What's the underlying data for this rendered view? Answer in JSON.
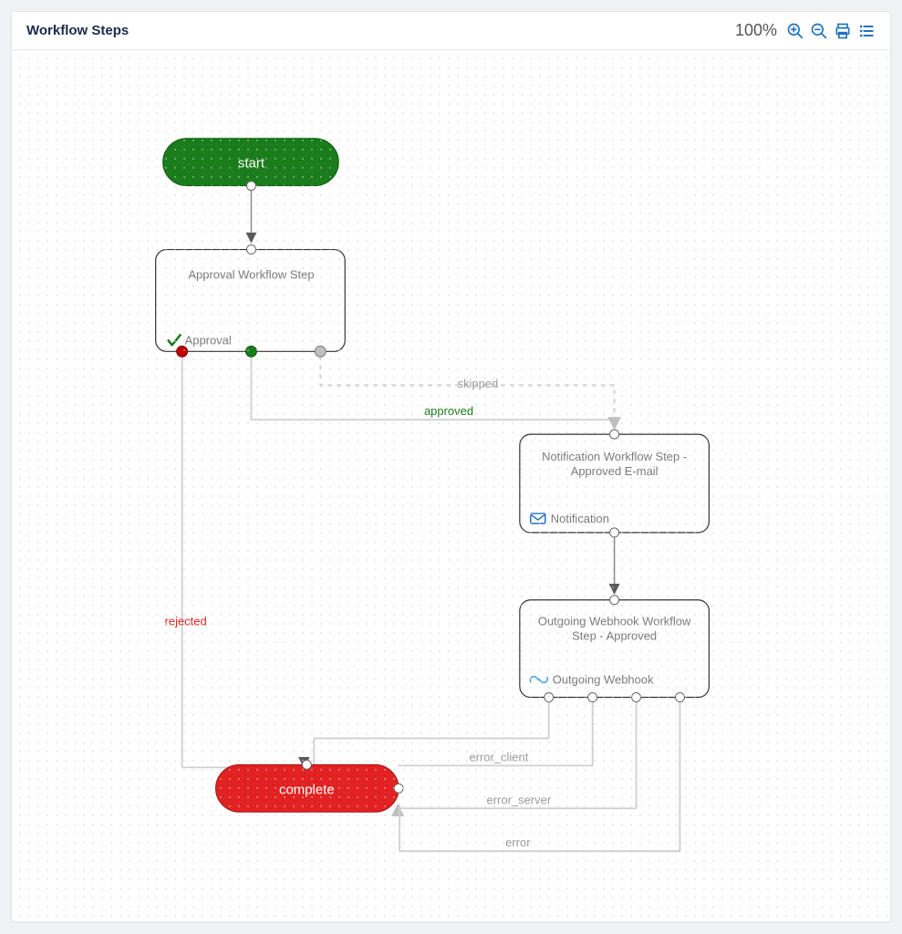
{
  "header": {
    "title": "Workflow Steps",
    "zoom_label": "100%"
  },
  "nodes": {
    "start": {
      "label": "start"
    },
    "approval": {
      "title": "Approval Workflow Step",
      "type_label": "Approval"
    },
    "notification": {
      "title1": "Notification Workflow Step -",
      "title2": "Approved E-mail",
      "type_label": "Notification"
    },
    "webhook": {
      "title1": "Outgoing Webhook Workflow",
      "title2": "Step - Approved",
      "type_label": "Outgoing Webhook"
    },
    "complete": {
      "label": "complete"
    }
  },
  "edges": {
    "approved": "approved",
    "rejected": "rejected",
    "skipped": "skipped",
    "error_client": "error_client",
    "error_server": "error_server",
    "error": "error"
  },
  "colors": {
    "start_fill": "#1a7c1a",
    "complete_fill": "#e22222",
    "node_stroke": "#333333",
    "port_green": "#1a7c1a",
    "port_red": "#c00000",
    "port_gray": "#aaaaaa",
    "edge_gray": "#cfcfcf",
    "edge_dark": "#8a8a8a",
    "label_green": "#1a7c1a",
    "label_red": "#e22222",
    "label_gray": "#9a9a9a",
    "toolbar_blue": "#2072c0"
  }
}
